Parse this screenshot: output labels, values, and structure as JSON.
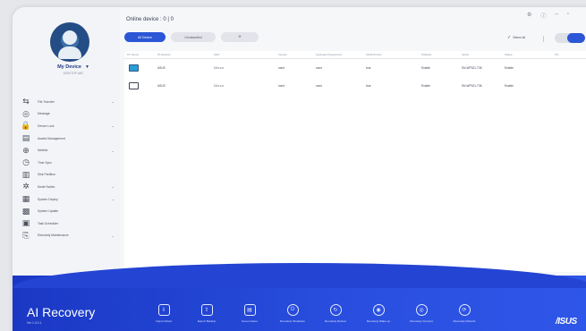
{
  "app": {
    "title": "Online device : 0 | 0",
    "brand": "AI Recovery",
    "brand_sub": "Ver 1.0.0.1",
    "vendor_logo": "/ISUS"
  },
  "window_controls": [
    "gear-icon",
    "help-icon",
    "minimize-icon",
    "close-icon"
  ],
  "window_control_glyphs": [
    "⚙",
    "ⓘ",
    "–",
    "▫"
  ],
  "sidebar": {
    "device_name": "My Device",
    "device_sub": "DESKTOP-ABC",
    "items": [
      {
        "label": "File Transfer",
        "icon": "file-transfer-icon",
        "glyph": "⇆",
        "has_children": true
      },
      {
        "label": "Message",
        "icon": "message-icon",
        "glyph": "◎",
        "has_children": false
      },
      {
        "label": "Device Lock",
        "icon": "lock-icon",
        "glyph": "🔒",
        "has_children": true
      },
      {
        "label": "Assets Management",
        "icon": "assets-icon",
        "glyph": "▤",
        "has_children": false
      },
      {
        "label": "Netdisk",
        "icon": "globe-icon",
        "glyph": "⊕",
        "has_children": true
      },
      {
        "label": "Time Sync",
        "icon": "clock-icon",
        "glyph": "◷",
        "has_children": false
      },
      {
        "label": "Disk Partition",
        "icon": "disk-icon",
        "glyph": "▥",
        "has_children": false
      },
      {
        "label": "Mode Switch",
        "icon": "switch-icon",
        "glyph": "✲",
        "has_children": true
      },
      {
        "label": "System Deploy",
        "icon": "system-icon",
        "glyph": "▦",
        "has_children": true
      },
      {
        "label": "System Update",
        "icon": "update-icon",
        "glyph": "▩",
        "has_children": false
      },
      {
        "label": "Task Scheduler",
        "icon": "scheduler-icon",
        "glyph": "▣",
        "has_children": false
      },
      {
        "label": "Remotely Maintenance",
        "icon": "remote-icon",
        "glyph": "⎘",
        "has_children": true
      }
    ]
  },
  "tabs": [
    {
      "label": "All Device",
      "active": true
    },
    {
      "label": "Unclassified",
      "active": false
    },
    {
      "label": "+",
      "active": false
    }
  ],
  "toolbar": {
    "select_all": "Select all"
  },
  "table": {
    "columns": [
      "PC Name",
      "IP Address",
      "MAC",
      "Version",
      "Keyboard Assignment",
      "CD/DVD Rec",
      "Whitelist",
      "Serial",
      "Status",
      "OS"
    ],
    "rows": [
      {
        "icon": "monitor-filled",
        "cells": [
          "",
          "ASUS",
          "10.x.x.x",
          "none",
          "none",
          "true",
          "Enable",
          "SN-WP321-T36",
          "Enable",
          ""
        ]
      },
      {
        "icon": "monitor-outline",
        "cells": [
          "",
          "ASUS",
          "10.x.x.x",
          "none",
          "none",
          "true",
          "Enable",
          "SN-WP321-T36",
          "Enable",
          ""
        ]
      }
    ]
  },
  "actions": [
    {
      "label": "Import Ghost",
      "icon": "import-icon",
      "glyph": "⇩",
      "round": false
    },
    {
      "label": "Export Backup",
      "icon": "export-icon",
      "glyph": "⇧",
      "round": false
    },
    {
      "label": "Green Game",
      "icon": "game-icon",
      "glyph": "▤",
      "round": false
    },
    {
      "label": "Remotely Shutdown",
      "icon": "shutdown-icon",
      "glyph": "⏻",
      "round": true
    },
    {
      "label": "Remotely Reboot",
      "icon": "reboot-icon",
      "glyph": "↻",
      "round": true
    },
    {
      "label": "Remotely Wake up",
      "icon": "wake-icon",
      "glyph": "◉",
      "round": true
    },
    {
      "label": "Remotely Connect",
      "icon": "connect-icon",
      "glyph": "◎",
      "round": true
    },
    {
      "label": "Remotely Refresh",
      "icon": "refresh-icon",
      "glyph": "⟳",
      "round": true
    }
  ],
  "colors": {
    "accent": "#2b56d6",
    "bottom_bar": "#2444d4"
  }
}
